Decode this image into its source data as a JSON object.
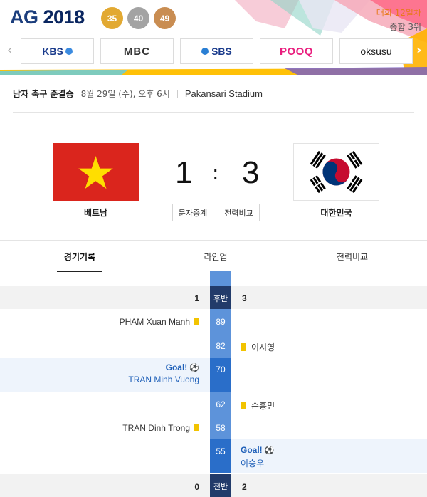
{
  "banner": {
    "logo": "AG",
    "logo_year": "2018",
    "medals": {
      "gold": "35",
      "silver": "40",
      "bronze": "49"
    },
    "day_label": "대회 12일차",
    "overall_rank": "종합 3위",
    "broadcasters": [
      "KBS",
      "MBC",
      "SBS",
      "POOQ",
      "oksusu"
    ]
  },
  "match": {
    "name": "남자 축구 준결승",
    "time": "8월 29일 (수), 오후 6시",
    "venue": "Pakansari Stadium",
    "home_team": "베트남",
    "away_team": "대한민국",
    "home_score": "1",
    "away_score": "3",
    "colon": ":",
    "buttons": {
      "text_relay": "문자중계",
      "compare": "전력비교"
    }
  },
  "tabs": [
    "경기기록",
    "라인업",
    "전력비교"
  ],
  "timeline": {
    "second_half": {
      "label": "후반",
      "home": "1",
      "away": "3"
    },
    "first_half": {
      "label": "전반",
      "home": "0",
      "away": "2"
    },
    "goal_label": "Goal!",
    "events": [
      {
        "minute": "89",
        "player": "PHAM Xuan Manh"
      },
      {
        "minute": "82",
        "player": "이시영"
      },
      {
        "minute": "70",
        "player": "TRAN Minh Vuong"
      },
      {
        "minute": "62",
        "player": "손흥민"
      },
      {
        "minute": "58",
        "player": "TRAN Dinh Trong"
      },
      {
        "minute": "55",
        "player": "이승우"
      }
    ]
  }
}
